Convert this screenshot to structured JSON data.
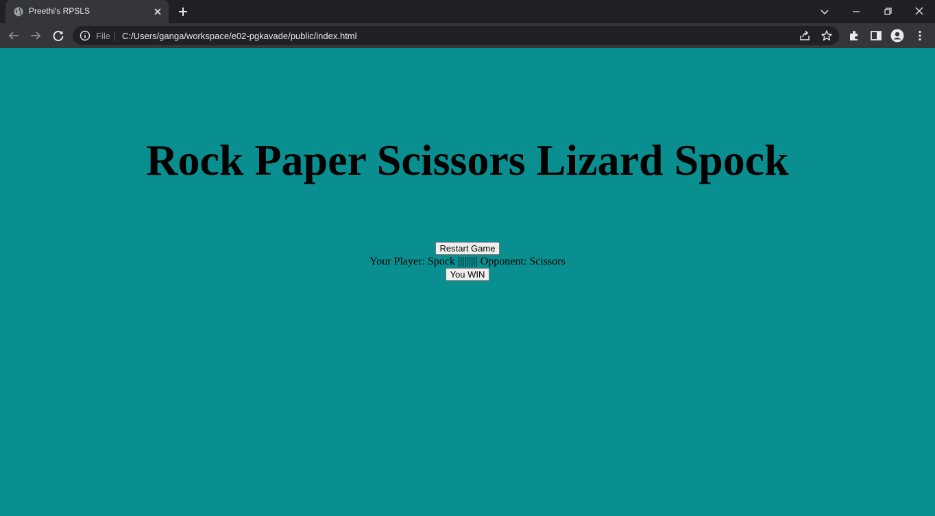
{
  "browser": {
    "tab_title": "Preethi's RPSLS",
    "address_scheme": "File",
    "address_url": "C:/Users/ganga/workspace/e02-pgkavade/public/index.html",
    "colors": {
      "chrome_bg": "#202124",
      "tab_bg": "#35363a",
      "page_bg": "#0a8f90"
    }
  },
  "page": {
    "heading": "Rock Paper Scissors Lizard Spock",
    "restart_label": "Restart Game",
    "result_text": "Your Player: Spock ||||||||| Opponent: Scissors",
    "outcome_label": "You WIN"
  }
}
